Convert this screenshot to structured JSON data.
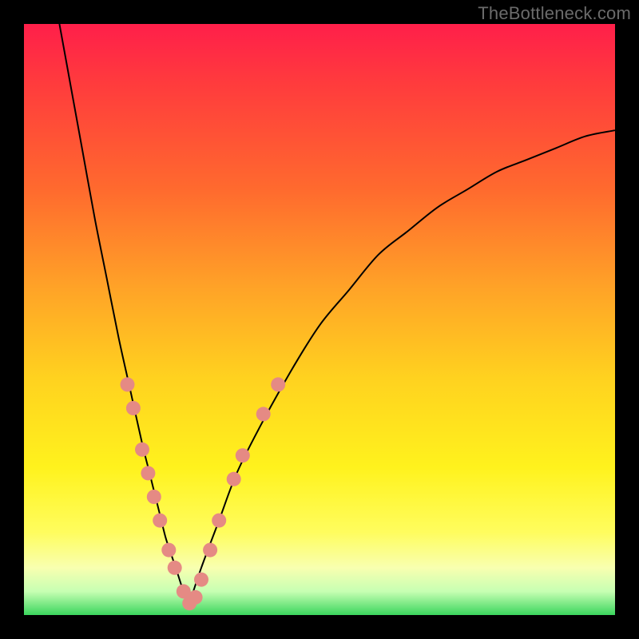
{
  "watermark": "TheBottleneck.com",
  "colors": {
    "dot": "#e58a84",
    "curve": "#000000",
    "gradient_stops": [
      {
        "pct": 0,
        "hex": "#ff1f4a"
      },
      {
        "pct": 10,
        "hex": "#ff3b3d"
      },
      {
        "pct": 28,
        "hex": "#ff6a2e"
      },
      {
        "pct": 45,
        "hex": "#ffa427"
      },
      {
        "pct": 60,
        "hex": "#ffd21f"
      },
      {
        "pct": 75,
        "hex": "#fff21d"
      },
      {
        "pct": 86,
        "hex": "#fffd5e"
      },
      {
        "pct": 92,
        "hex": "#f8ffb0"
      },
      {
        "pct": 96,
        "hex": "#c7ffb3"
      },
      {
        "pct": 100,
        "hex": "#3bd65d"
      }
    ]
  },
  "chart_data": {
    "type": "line",
    "title": "",
    "xlabel": "",
    "ylabel": "",
    "xlim": [
      0,
      100
    ],
    "ylim": [
      0,
      100
    ],
    "series": [
      {
        "name": "left-curve",
        "x": [
          6,
          8,
          10,
          12,
          14,
          16,
          18,
          20,
          21,
          22,
          23,
          24,
          25,
          26,
          27,
          28
        ],
        "y": [
          100,
          89,
          78,
          67,
          57,
          47,
          38,
          29,
          25,
          21,
          17,
          13,
          10,
          7,
          4,
          2
        ]
      },
      {
        "name": "right-curve",
        "x": [
          28,
          30,
          33,
          36,
          40,
          45,
          50,
          55,
          60,
          65,
          70,
          75,
          80,
          85,
          90,
          95,
          100
        ],
        "y": [
          2,
          8,
          16,
          24,
          32,
          41,
          49,
          55,
          61,
          65,
          69,
          72,
          75,
          77,
          79,
          81,
          82
        ]
      }
    ],
    "overlay_points": {
      "name": "highlight-dots",
      "points": [
        {
          "x": 17.5,
          "y": 39
        },
        {
          "x": 18.5,
          "y": 35
        },
        {
          "x": 20.0,
          "y": 28
        },
        {
          "x": 21.0,
          "y": 24
        },
        {
          "x": 22.0,
          "y": 20
        },
        {
          "x": 23.0,
          "y": 16
        },
        {
          "x": 24.5,
          "y": 11
        },
        {
          "x": 25.5,
          "y": 8
        },
        {
          "x": 27.0,
          "y": 4
        },
        {
          "x": 28.0,
          "y": 2
        },
        {
          "x": 29.0,
          "y": 3
        },
        {
          "x": 30.0,
          "y": 6
        },
        {
          "x": 31.5,
          "y": 11
        },
        {
          "x": 33.0,
          "y": 16
        },
        {
          "x": 35.5,
          "y": 23
        },
        {
          "x": 37.0,
          "y": 27
        },
        {
          "x": 40.5,
          "y": 34
        },
        {
          "x": 43.0,
          "y": 39
        }
      ]
    }
  }
}
